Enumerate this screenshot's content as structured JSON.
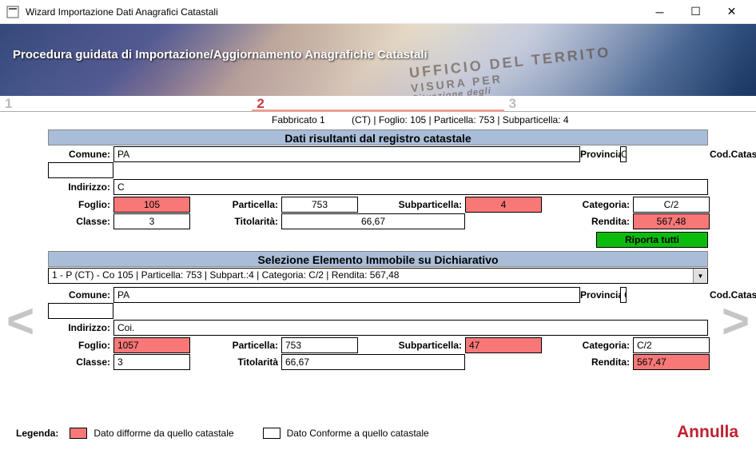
{
  "window": {
    "title": "Wizard Importazione Dati Anagrafici Catastali"
  },
  "header": {
    "title": "Procedura guidata di Importazione/Aggiornamento Anagrafiche Catastali",
    "watermark_line1": "UFFICIO DEL TERRITO",
    "watermark_line2": "VISURA PER",
    "watermark_line3": "Situazione degli"
  },
  "steps": {
    "s1": "1",
    "s2": "2",
    "s3": "3",
    "active": "2"
  },
  "context": {
    "fabbricato": "Fabbricato 1",
    "suffix": "(CT)  |  Foglio: 105  |  Particella: 753  |  Subparticella: 4"
  },
  "section1": {
    "title": "Dati risultanti dal registro catastale",
    "labels": {
      "comune": "Comune:",
      "provincia": "Provincia:",
      "codcat": "Cod.Catastale:",
      "indirizzo": "Indirizzo:",
      "foglio": "Foglio:",
      "particella": "Particella:",
      "subparticella": "Subparticella:",
      "categoria": "Categoria:",
      "classe": "Classe:",
      "titolarita": "Titolarità:",
      "rendita": "Rendita:"
    },
    "values": {
      "comune": "PA",
      "provincia": "CT",
      "codcat": "",
      "indirizzo": "C",
      "foglio": "105",
      "particella": "753",
      "subparticella": "4",
      "categoria": "C/2",
      "classe": "3",
      "titolarita": "66,67",
      "rendita": "567,48"
    },
    "btn_riporta": "Riporta tutti"
  },
  "section2": {
    "title": "Selezione Elemento Immobile su Dichiarativo",
    "dropdown": "1 - P           (CT) - Co                                     105 | Particella: 753 | Subpart.:4 | Categoria: C/2 | Rendita: 567,48",
    "labels": {
      "comune": "Comune:",
      "provincia": "Provincia:",
      "codcat": "Cod.Catastale:",
      "indirizzo": "Indirizzo:",
      "foglio": "Foglio:",
      "particella": "Particella:",
      "subparticella": "Subparticella:",
      "categoria": "Categoria:",
      "classe": "Classe:",
      "titolarita": "Titolarità",
      "rendita": "Rendita:"
    },
    "values": {
      "comune": "PA",
      "provincia": "CT",
      "codcat": "",
      "indirizzo": "Coi.",
      "foglio": "1057",
      "particella": "753",
      "subparticella": "47",
      "categoria": "C/2",
      "classe": "3",
      "titolarita": "66,67",
      "rendita": "567,47"
    }
  },
  "legend": {
    "label": "Legenda:",
    "difforme": "Dato difforme da quello catastale",
    "conforme": "Dato Conforme a quello catastale"
  },
  "annulla": "Annulla"
}
